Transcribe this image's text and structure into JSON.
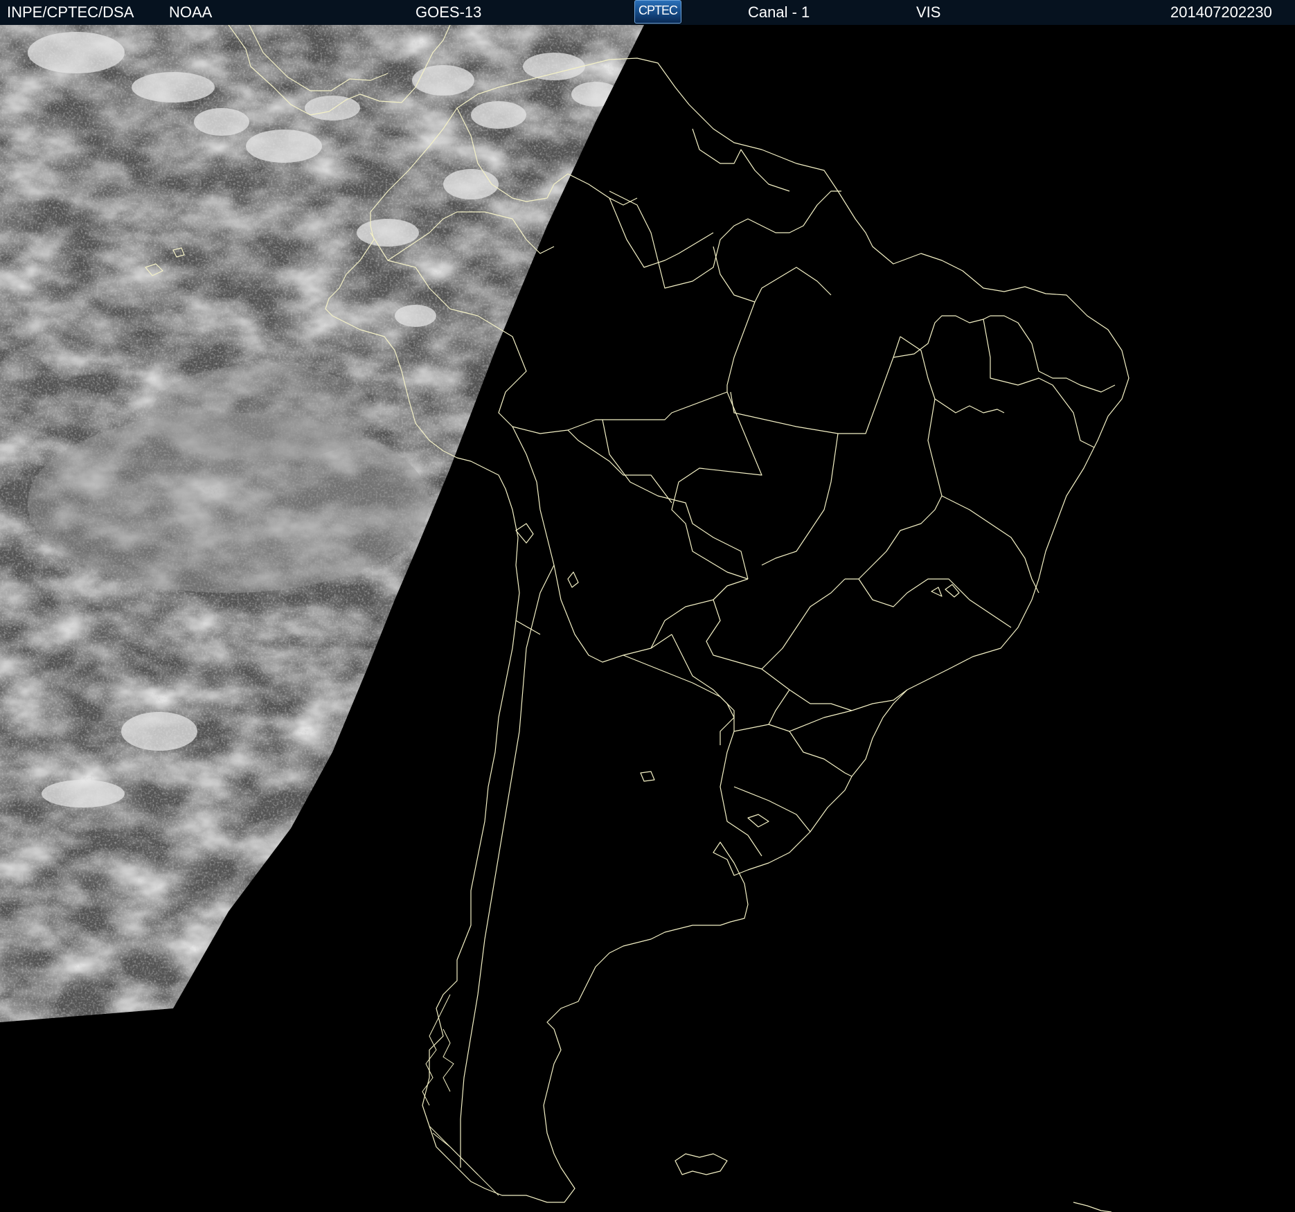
{
  "header": {
    "institution": "INPE/CPTEC/DSA",
    "agency": "NOAA",
    "satellite": "GOES-13",
    "logo_text": "CPTEC",
    "channel": "Canal - 1",
    "band": "VIS",
    "timestamp": "201407202230"
  },
  "map": {
    "region": "South America",
    "imagery": "visible satellite (daylight portion west of terminator)",
    "terminator_color": "#000000",
    "border_color": "#f4f1c6",
    "cloud_tone": "#c8c8c8"
  }
}
